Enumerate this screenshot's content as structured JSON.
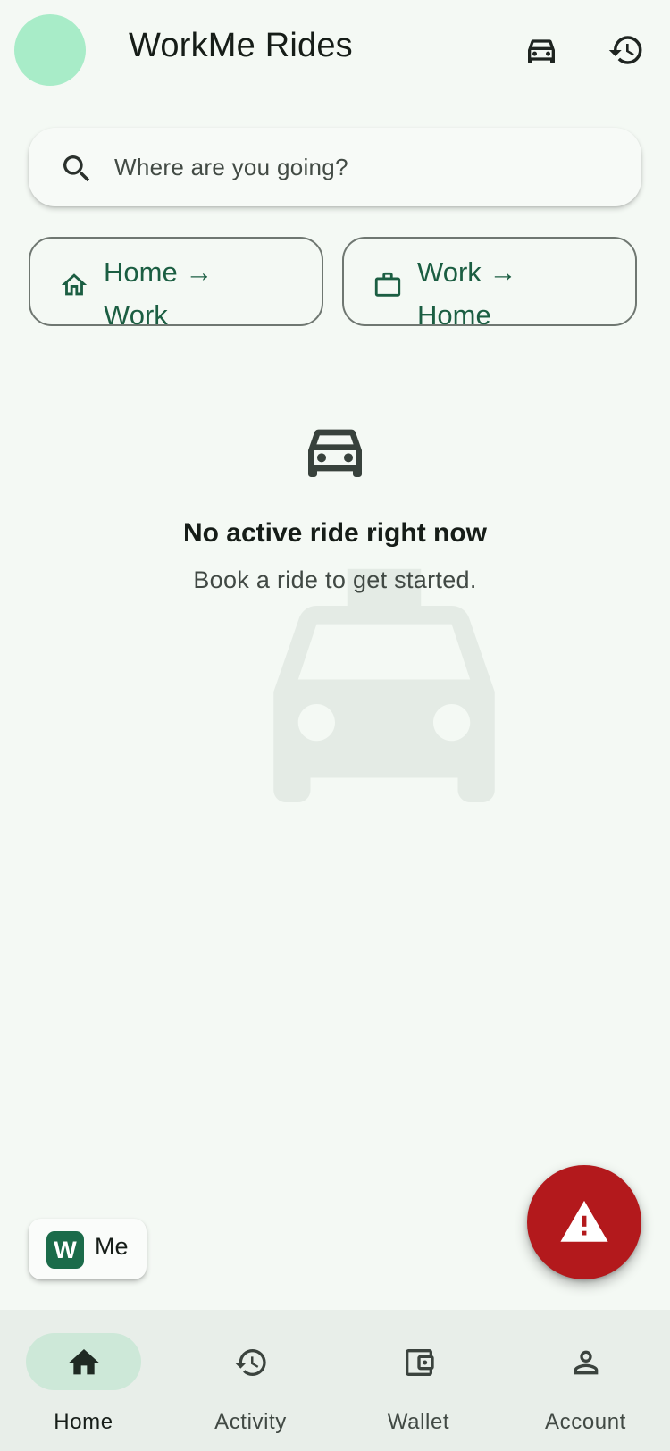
{
  "app": {
    "title": "WorkMe Rides"
  },
  "header": {
    "actions": [
      {
        "icon": "car-icon",
        "label": "Rides"
      },
      {
        "icon": "history-icon",
        "label": "History"
      }
    ]
  },
  "search": {
    "placeholder": "Where are you going?"
  },
  "quick_routes": [
    {
      "icon": "home-icon",
      "label": "Home → Work"
    },
    {
      "icon": "briefcase-icon",
      "label": "Work → Home"
    }
  ],
  "empty_state": {
    "icon": "car-icon",
    "title": "No active ride right now",
    "subtitle": "Book a ride to get started."
  },
  "me_badge": {
    "logo_letter": "W",
    "label": "Me"
  },
  "sos": {
    "icon": "warning-icon",
    "color": "#b3191c"
  },
  "bottom_nav": {
    "active": "Home",
    "items": [
      {
        "label": "Home",
        "icon": "home-filled-icon"
      },
      {
        "label": "Activity",
        "icon": "history-icon"
      },
      {
        "label": "Wallet",
        "icon": "wallet-icon"
      },
      {
        "label": "Account",
        "icon": "account-icon"
      }
    ]
  },
  "colors": {
    "background": "#f4f9f4",
    "primary": "#1b6b4a",
    "avatar": "#a8ecc8",
    "active_nav_pill": "#cde8d8",
    "nav_background": "#e8eee9"
  }
}
